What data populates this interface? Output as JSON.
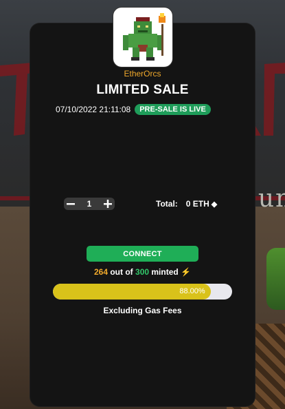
{
  "brand": "EtherOrcs",
  "title": "LIMITED SALE",
  "datetime": "07/10/2022 21:11:08",
  "status_badge": "PRE-SALE IS LIVE",
  "quantity": {
    "decrement_icon": "minus-icon",
    "value": "1",
    "increment_icon": "plus-icon"
  },
  "total": {
    "label": "Total:",
    "value": "0 ETH",
    "currency_icon": "eth-diamond-icon"
  },
  "connect_label": "CONNECT",
  "minted": {
    "count": "264",
    "out_of": "out of",
    "max": "300",
    "suffix": "minted",
    "icon": "lightning-icon"
  },
  "progress": {
    "percent_label": "88.00%",
    "fraction": 0.88
  },
  "gas_note": "Excluding Gas Fees",
  "background_text": "Dun",
  "colors": {
    "brand": "#f0a92c",
    "badge": "#1f9d5a",
    "connect": "#1fae57",
    "progress_fill": "#d9c21a",
    "minted_max": "#32c86a"
  }
}
